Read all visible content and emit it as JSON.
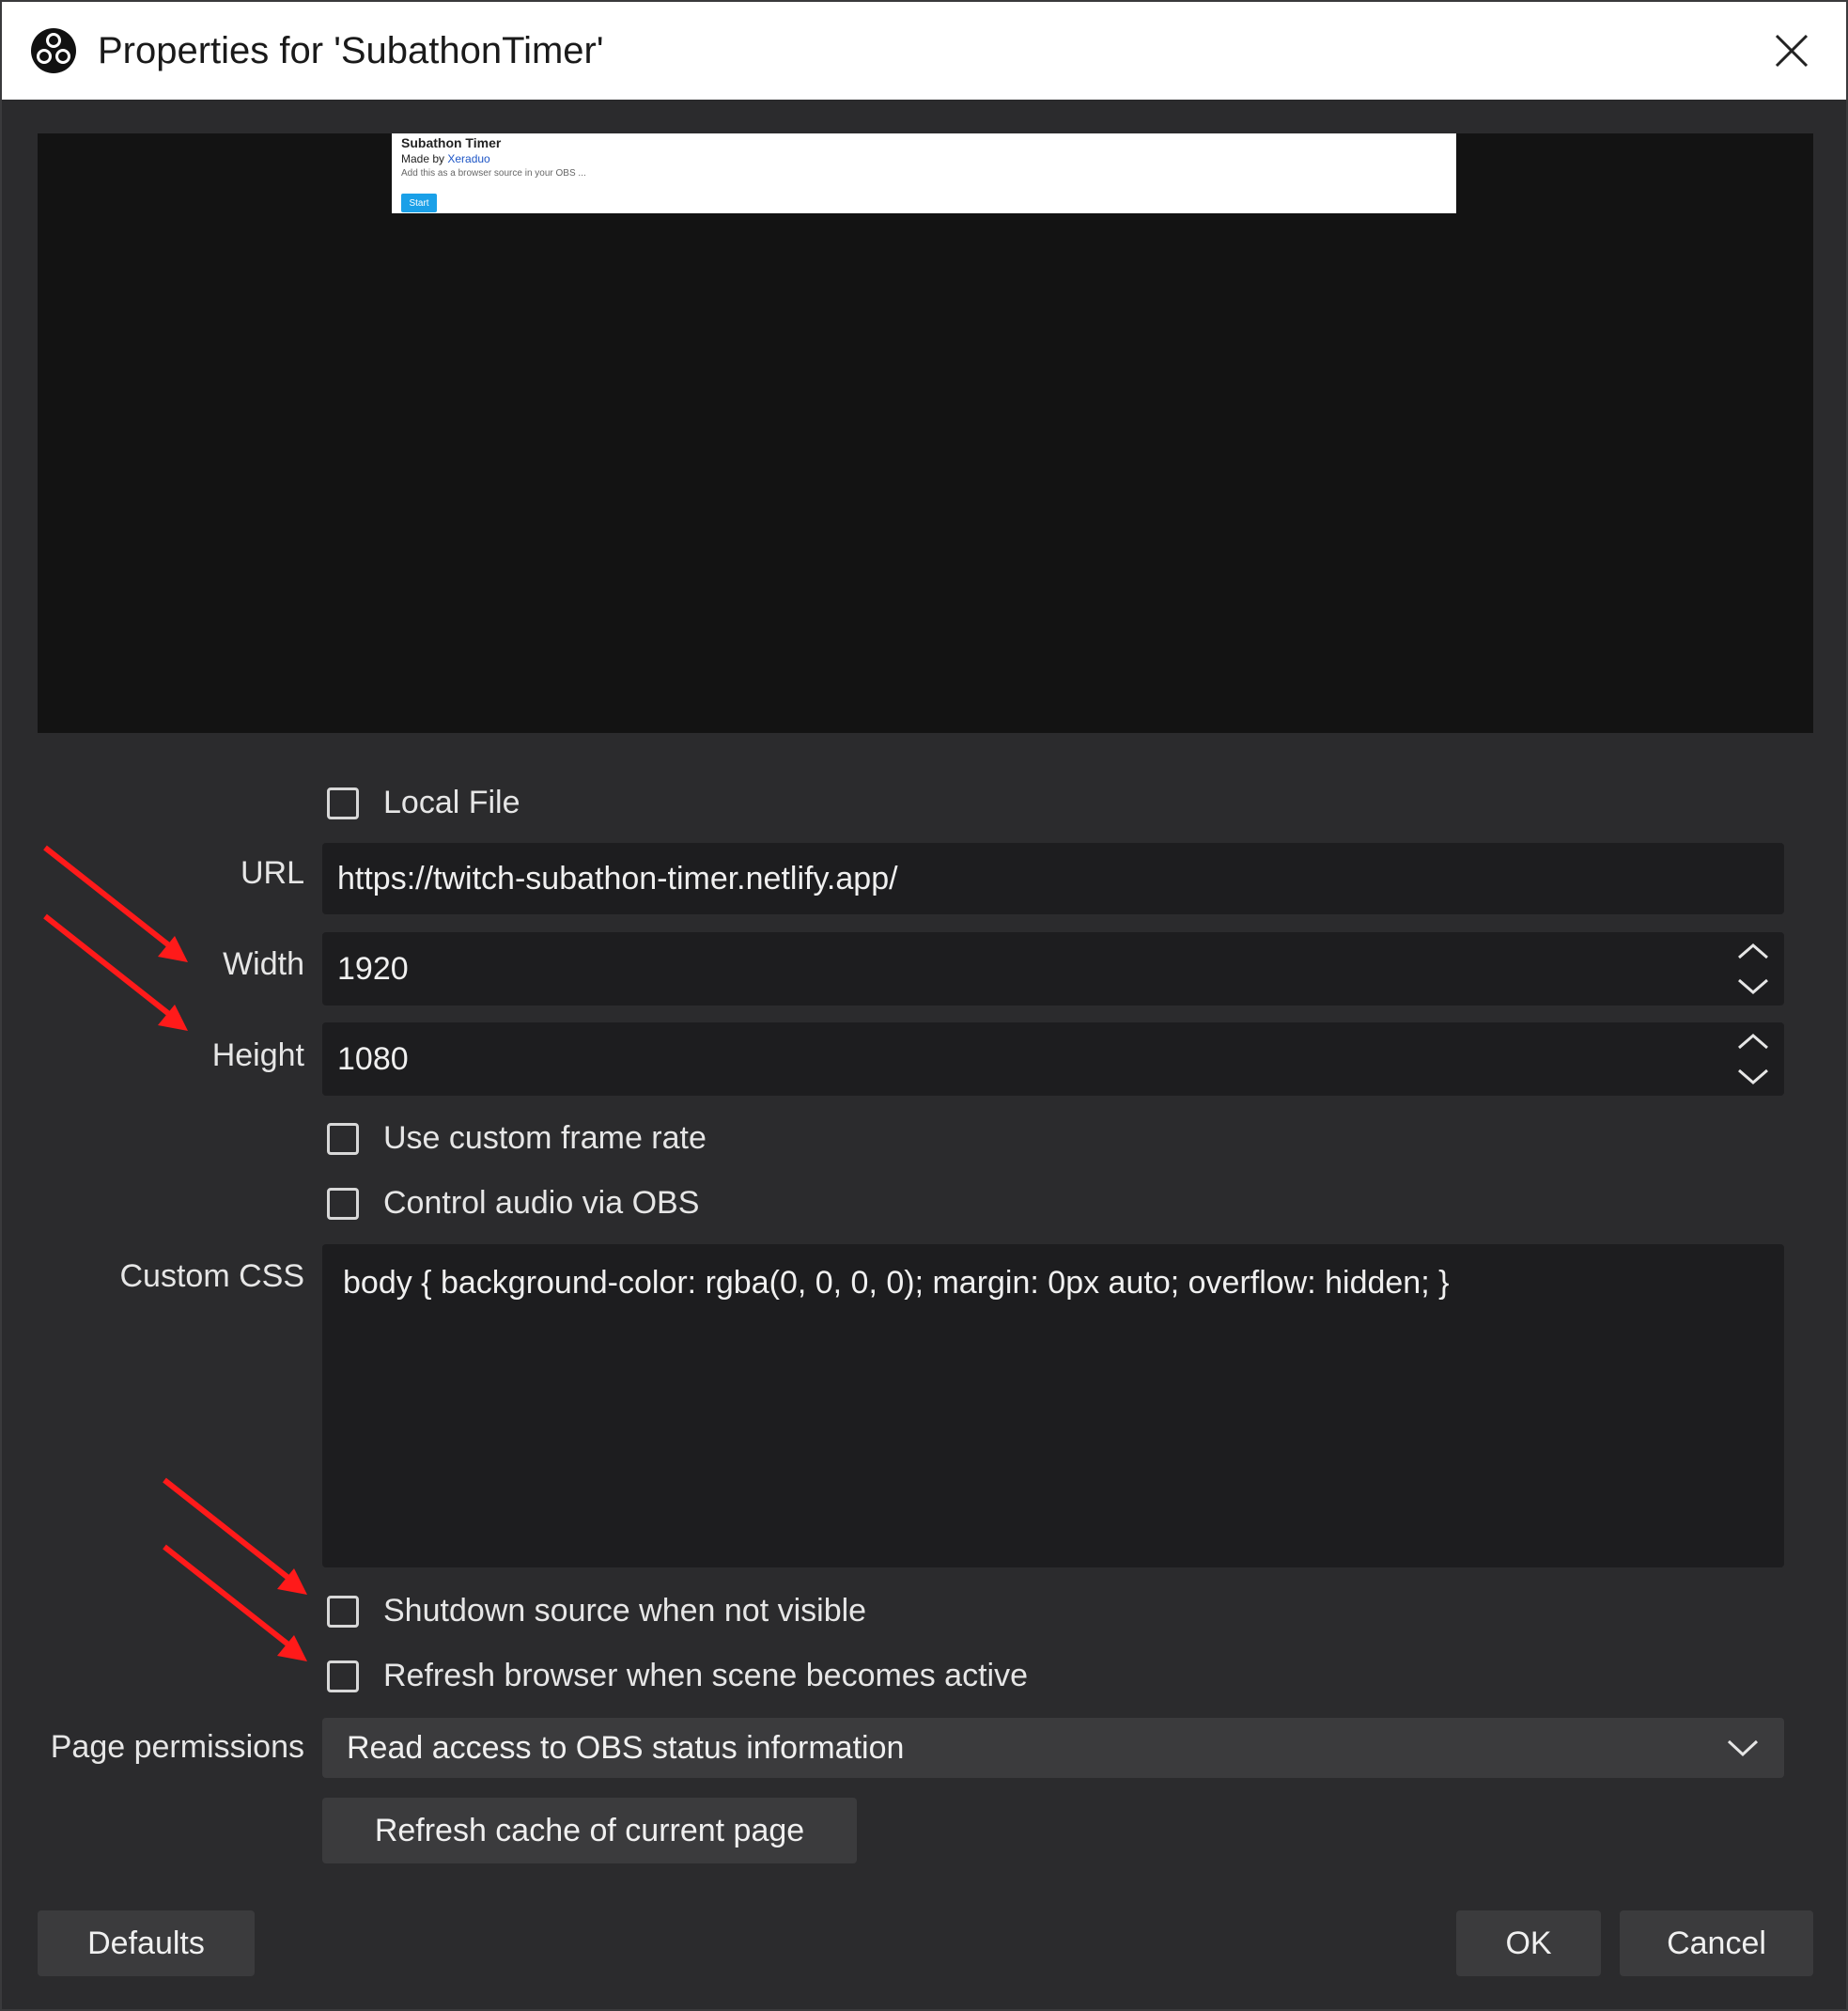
{
  "window": {
    "title": "Properties for 'SubathonTimer'"
  },
  "preview": {
    "page_title": "Subathon Timer",
    "byline_prefix": "Made by ",
    "byline_link": "Xeraduo",
    "description": "Add this as a browser source in your OBS ...",
    "button_label": "Start"
  },
  "form": {
    "local_file_label": "Local File",
    "url_label": "URL",
    "url_value": "https://twitch-subathon-timer.netlify.app/",
    "width_label": "Width",
    "width_value": "1920",
    "height_label": "Height",
    "height_value": "1080",
    "custom_frame_rate_label": "Use custom frame rate",
    "control_audio_label": "Control audio via OBS",
    "custom_css_label": "Custom CSS",
    "custom_css_value": "body { background-color: rgba(0, 0, 0, 0); margin: 0px auto; overflow: hidden; }",
    "shutdown_label": "Shutdown source when not visible",
    "refresh_on_active_label": "Refresh browser when scene becomes active",
    "page_permissions_label": "Page permissions",
    "page_permissions_value": "Read access to OBS status information",
    "refresh_cache_label": "Refresh cache of current page"
  },
  "footer": {
    "defaults_label": "Defaults",
    "ok_label": "OK",
    "cancel_label": "Cancel"
  },
  "colors": {
    "annotation_arrow": "#ff1a1a",
    "dialog_bg": "#2b2b2d",
    "field_bg": "#1d1d1f",
    "button_bg": "#3b3b3d"
  },
  "icons": {
    "app": "obs-logo-icon",
    "close": "close-icon",
    "spin_up": "chevron-up-icon",
    "spin_down": "chevron-down-icon",
    "dropdown": "chevron-down-icon",
    "annotation": "red-arrow-icon"
  }
}
